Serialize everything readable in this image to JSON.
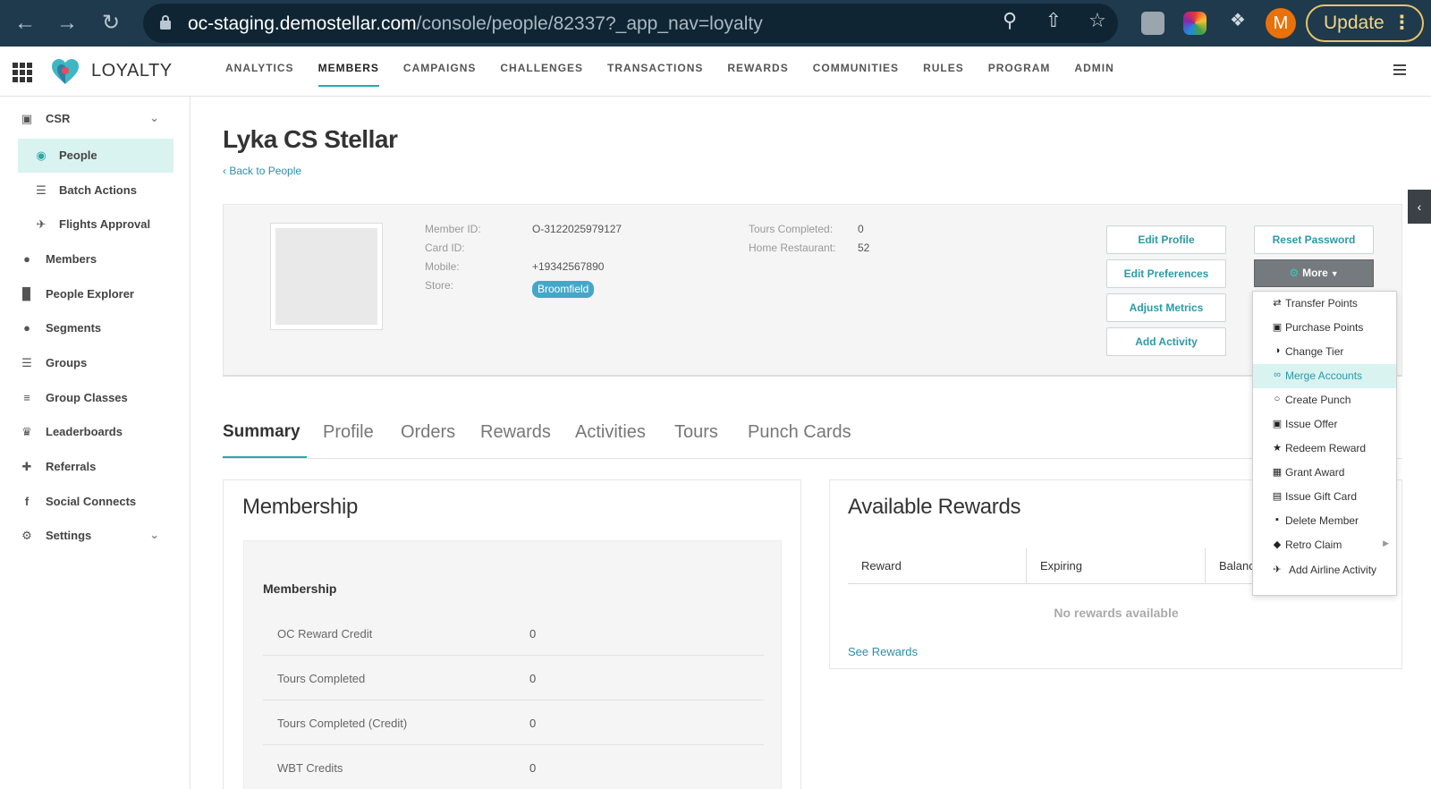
{
  "browser": {
    "url_host": "oc-staging.demostellar.com",
    "url_path": "/console/people/82337?_app_nav=loyalty",
    "avatar_letter": "M",
    "update_label": "Update"
  },
  "app": {
    "brand": "LOYALTY",
    "nav": [
      "ANALYTICS",
      "MEMBERS",
      "CAMPAIGNS",
      "CHALLENGES",
      "TRANSACTIONS",
      "REWARDS",
      "COMMUNITIES",
      "RULES",
      "PROGRAM",
      "ADMIN"
    ],
    "active_nav": "MEMBERS"
  },
  "sidebar": {
    "items": [
      {
        "label": "CSR",
        "icon": "lock-icon"
      },
      {
        "label": "People",
        "icon": "person-circle-icon"
      },
      {
        "label": "Batch Actions",
        "icon": "list-icon"
      },
      {
        "label": "Flights Approval",
        "icon": "plane-icon"
      },
      {
        "label": "Members",
        "icon": "user-icon"
      },
      {
        "label": "People Explorer",
        "icon": "bar-chart-icon"
      },
      {
        "label": "Segments",
        "icon": "users-icon"
      },
      {
        "label": "Groups",
        "icon": "list-icon"
      },
      {
        "label": "Group Classes",
        "icon": "bars-icon"
      },
      {
        "label": "Leaderboards",
        "icon": "trophy-icon"
      },
      {
        "label": "Referrals",
        "icon": "user-plus-icon"
      },
      {
        "label": "Social Connects",
        "icon": "facebook-icon"
      },
      {
        "label": "Settings",
        "icon": "gears-icon"
      }
    ]
  },
  "member": {
    "name": "Lyka CS Stellar",
    "back_link": "Back to People",
    "fields": {
      "member_id_label": "Member ID:",
      "member_id": "O-3122025979127",
      "card_id_label": "Card ID:",
      "mobile_label": "Mobile:",
      "mobile": "+19342567890",
      "store_label": "Store:",
      "store": "Broomfield",
      "tours_label": "Tours Completed:",
      "tours": "0",
      "home_label": "Home Restaurant:",
      "home": "52"
    },
    "actions": {
      "edit_profile": "Edit Profile",
      "edit_preferences": "Edit Preferences",
      "adjust_metrics": "Adjust Metrics",
      "add_activity": "Add Activity",
      "reset_password": "Reset Password",
      "more": "More"
    }
  },
  "more_menu": [
    {
      "label": "Transfer Points",
      "icon": "exchange-icon"
    },
    {
      "label": "Purchase Points",
      "icon": "cart-icon"
    },
    {
      "label": "Change Tier",
      "icon": "half-circle-icon"
    },
    {
      "label": "Merge Accounts",
      "icon": "handshake-icon"
    },
    {
      "label": "Create Punch",
      "icon": "circle-outline-icon"
    },
    {
      "label": "Issue Offer",
      "icon": "cart-icon"
    },
    {
      "label": "Redeem Reward",
      "icon": "star-icon"
    },
    {
      "label": "Grant Award",
      "icon": "gift-icon"
    },
    {
      "label": "Issue Gift Card",
      "icon": "credit-card-icon"
    },
    {
      "label": "Delete Member",
      "icon": "trash-icon"
    },
    {
      "label": "Retro Claim",
      "icon": "tag-icon"
    },
    {
      "label": "Add Airline Activity",
      "icon": "plane-icon"
    }
  ],
  "tabs": [
    "Summary",
    "Profile",
    "Orders",
    "Rewards",
    "Activities",
    "Tours",
    "Punch Cards"
  ],
  "membership": {
    "title": "Membership",
    "section": "Membership",
    "rows": [
      {
        "label": "OC Reward Credit",
        "value": "0"
      },
      {
        "label": "Tours Completed",
        "value": "0"
      },
      {
        "label": "Tours Completed (Credit)",
        "value": "0"
      },
      {
        "label": "WBT Credits",
        "value": "0"
      }
    ]
  },
  "rewards": {
    "title": "Available Rewards",
    "columns": [
      "Reward",
      "Expiring",
      "Balanc"
    ],
    "empty": "No rewards available",
    "see_link": "See Rewards"
  }
}
